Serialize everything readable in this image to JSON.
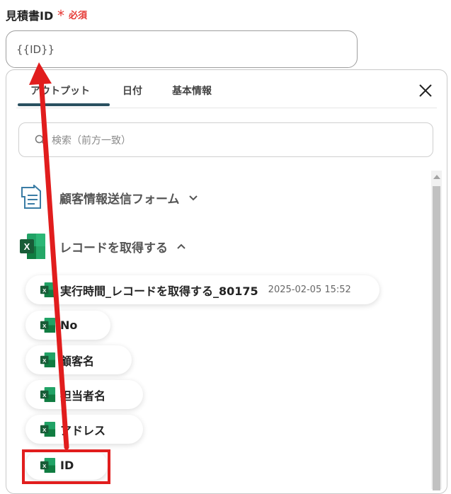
{
  "field": {
    "label": "見積書ID",
    "required_mark": "*",
    "required_text": "必須",
    "value": "{{ID}}"
  },
  "panel": {
    "tabs": [
      {
        "label": "アウトプット",
        "active": true
      },
      {
        "label": "日付",
        "active": false
      },
      {
        "label": "基本情報",
        "active": false
      }
    ],
    "search_placeholder": "検索（前方一致）",
    "groups": [
      {
        "label": "顧客情報送信フォーム",
        "icon": "form-icon",
        "expanded": false
      },
      {
        "label": "レコードを取得する",
        "icon": "excel-icon",
        "expanded": true
      }
    ],
    "items": [
      {
        "label": "実行時間_レコードを取得する_80175",
        "meta": "2025-02-05 15:52"
      },
      {
        "label": "No"
      },
      {
        "label": "顧客名"
      },
      {
        "label": "担当者名"
      },
      {
        "label": "アドレス"
      },
      {
        "label": "ID"
      }
    ]
  },
  "colors": {
    "accent": "#2a5060",
    "required": "#e53935",
    "annotation": "#e11d1d",
    "excel_green": "#1e7145"
  }
}
